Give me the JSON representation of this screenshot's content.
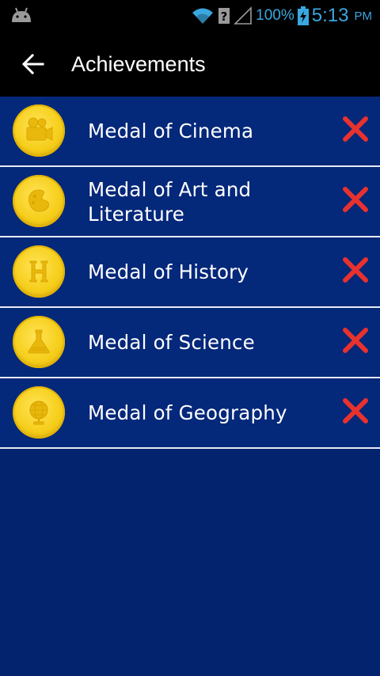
{
  "status_bar": {
    "battery": "100%",
    "time": "5:13",
    "ampm": "PM"
  },
  "app_bar": {
    "title": "Achievements"
  },
  "achievements": [
    {
      "label": "Medal of Cinema",
      "icon": "film-camera-icon",
      "status": "not-earned"
    },
    {
      "label": "Medal of Art and Literature",
      "icon": "palette-icon",
      "status": "not-earned"
    },
    {
      "label": "Medal of History",
      "icon": "letter-h-icon",
      "status": "not-earned"
    },
    {
      "label": "Medal of Science",
      "icon": "flask-icon",
      "status": "not-earned"
    },
    {
      "label": "Medal of Geography",
      "icon": "globe-icon",
      "status": "not-earned"
    }
  ],
  "colors": {
    "background": "#03236e",
    "bar": "#000000",
    "medal": "#f6cf1c",
    "x_mark": "#e8322e",
    "status_icons": "#3aa7e0"
  }
}
